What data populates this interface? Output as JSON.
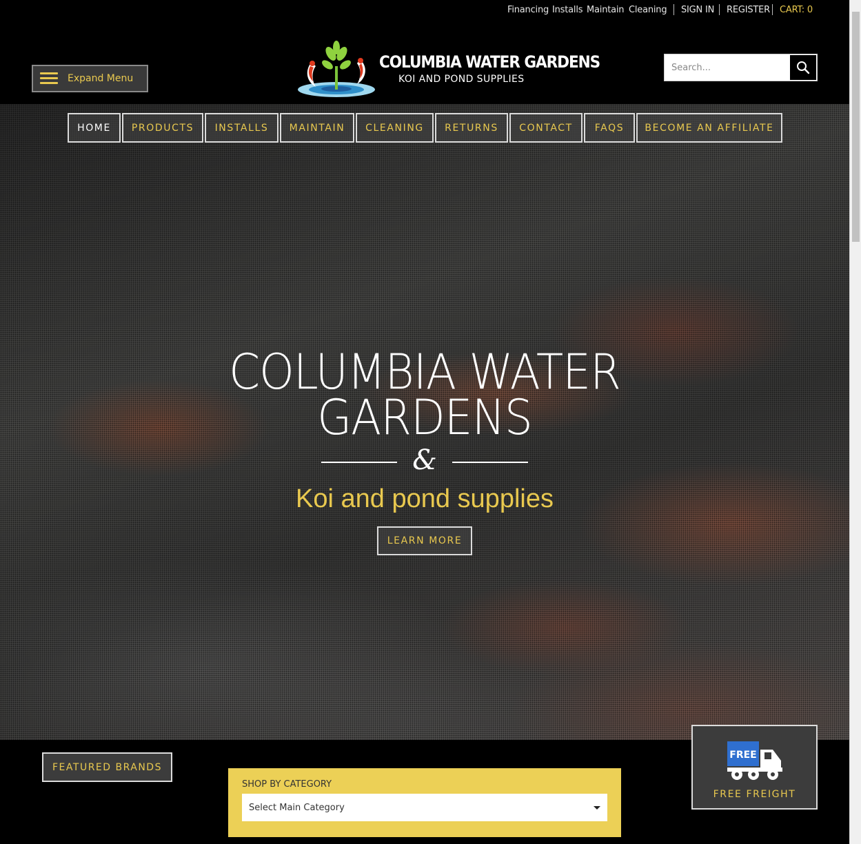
{
  "topbar": {
    "links": [
      "Financing",
      "Installs",
      "Maintain",
      "Cleaning"
    ],
    "sign_in": "SIGN IN",
    "register": "REGISTER",
    "cart": "CART: 0"
  },
  "header": {
    "expand_menu": "Expand Menu",
    "logo_title": "COLUMBIA WATER GARDENS",
    "logo_subtitle": "KOI AND POND SUPPLIES",
    "search_placeholder": "Search..."
  },
  "nav": {
    "items": [
      "HOME",
      "PRODUCTS",
      "INSTALLS",
      "MAINTAIN",
      "CLEANING",
      "RETURNS",
      "CONTACT",
      "FAQS",
      "BECOME AN AFFILIATE"
    ]
  },
  "hero": {
    "title_line1": "COLUMBIA WATER",
    "title_line2": "GARDENS",
    "ampersand": "&",
    "subtitle": "Koi and pond supplies",
    "button": "LEARN MORE"
  },
  "bottom": {
    "featured_brands": "FEATURED BRANDS",
    "shop_by_category": "SHOP BY CATEGORY",
    "category_select_value": "Select Main Category",
    "free_badge": "FREE",
    "free_freight": "FREE FREIGHT"
  },
  "colors": {
    "accent_yellow": "#e9c94f",
    "category_bg": "#ecd056",
    "background": "#000000"
  }
}
